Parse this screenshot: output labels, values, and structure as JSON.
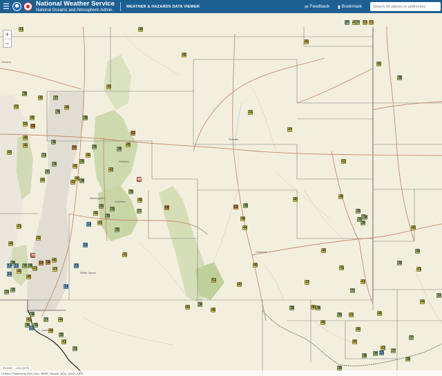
{
  "header": {
    "menu_icon": "hamburger-icon",
    "title": "National Weather Service",
    "subtitle": "National Oceanic and Atmospheric Admin.",
    "app_title": "WEATHER & HAZARDS DATA VIEWER",
    "feedback_label": "Feedback",
    "bookmark_label": "Bookmark",
    "search_placeholder": "Search for places or addresses"
  },
  "zoom": {
    "in_label": "+",
    "out_label": "−"
  },
  "colors": {
    "header": "#1e5f92",
    "map_background": "#f3efdf",
    "obs_40": "#e8d84a",
    "obs_30": "#b5d77a",
    "obs_20": "#8dcf9e",
    "obs_10": "#6fb9ea",
    "obs_60": "#e9a03c",
    "obs_80": "#d94a2a"
  },
  "towns": [
    "Socorro",
    "Roswell",
    "Carlsbad",
    "Alamogordo",
    "Juarez",
    "Ruidoso",
    "Tularosa",
    "White Sands"
  ],
  "observations": [
    {
      "id": "o1",
      "v": "41"
    },
    {
      "id": "o2",
      "v": "40"
    },
    {
      "id": "o3",
      "v": "52"
    },
    {
      "id": "o4",
      "v": "51"
    },
    {
      "id": "o5",
      "v": "42"
    },
    {
      "id": "o6",
      "v": "27"
    },
    {
      "id": "o7",
      "v": "37"
    },
    {
      "id": "o8",
      "v": "40"
    },
    {
      "id": "o9",
      "v": "40"
    },
    {
      "id": "o10",
      "v": "40"
    },
    {
      "id": "o11",
      "v": "45"
    },
    {
      "id": "o12",
      "v": "38"
    },
    {
      "id": "o13",
      "v": "38"
    },
    {
      "id": "o14",
      "v": "40"
    },
    {
      "id": "o15",
      "v": "37"
    },
    {
      "id": "o16",
      "v": "36"
    },
    {
      "id": "o17",
      "v": "46"
    },
    {
      "id": "o18",
      "v": "49"
    },
    {
      "id": "o19",
      "v": "41"
    },
    {
      "id": "o20",
      "v": "38"
    },
    {
      "id": "o21",
      "v": "50"
    },
    {
      "id": "o22",
      "v": "58"
    },
    {
      "id": "o23",
      "v": "62"
    },
    {
      "id": "o24",
      "v": "46"
    },
    {
      "id": "o25",
      "v": "45"
    },
    {
      "id": "o26",
      "v": "55"
    },
    {
      "id": "o27",
      "v": "36"
    },
    {
      "id": "o28",
      "v": "31"
    },
    {
      "id": "o29",
      "v": "40"
    },
    {
      "id": "o30",
      "v": "43"
    },
    {
      "id": "o31",
      "v": "36"
    },
    {
      "id": "o32",
      "v": "39"
    },
    {
      "id": "o33",
      "v": "41"
    },
    {
      "id": "o34",
      "v": "52"
    },
    {
      "id": "o35",
      "v": "47"
    },
    {
      "id": "o36",
      "v": "40"
    },
    {
      "id": "o37",
      "v": "30"
    },
    {
      "id": "o38",
      "v": "39"
    },
    {
      "id": "o39",
      "v": "30"
    },
    {
      "id": "o40",
      "v": "40"
    },
    {
      "id": "o41",
      "v": "40"
    },
    {
      "id": "o42",
      "v": "42"
    },
    {
      "id": "o43",
      "v": "83"
    },
    {
      "id": "o44",
      "v": "43"
    },
    {
      "id": "o45",
      "v": "40"
    },
    {
      "id": "o46",
      "v": "38"
    },
    {
      "id": "o47",
      "v": "35"
    },
    {
      "id": "o48",
      "v": "12"
    },
    {
      "id": "o49",
      "v": "10"
    },
    {
      "id": "o50",
      "v": "13"
    },
    {
      "id": "o51",
      "v": "14"
    },
    {
      "id": "o52",
      "v": "39"
    },
    {
      "id": "o53",
      "v": "40"
    },
    {
      "id": "o54",
      "v": "43"
    },
    {
      "id": "o55",
      "v": "68"
    },
    {
      "id": "o56",
      "v": "35"
    },
    {
      "id": "o57",
      "v": "39"
    },
    {
      "id": "o58",
      "v": "40"
    },
    {
      "id": "o59",
      "v": "37"
    },
    {
      "id": "o60",
      "v": "39"
    },
    {
      "id": "o61",
      "v": "41"
    },
    {
      "id": "o62",
      "v": "73"
    },
    {
      "id": "o63",
      "v": "64"
    },
    {
      "id": "o64",
      "v": "58"
    },
    {
      "id": "o65",
      "v": "44"
    },
    {
      "id": "o66",
      "v": "42"
    },
    {
      "id": "o67",
      "v": "43"
    },
    {
      "id": "o68",
      "v": "47"
    },
    {
      "id": "o69",
      "v": "38"
    },
    {
      "id": "o70",
      "v": "39"
    },
    {
      "id": "o71",
      "v": "38"
    },
    {
      "id": "o72",
      "v": "40"
    },
    {
      "id": "o73",
      "v": "14"
    },
    {
      "id": "o74",
      "v": "10"
    },
    {
      "id": "o75",
      "v": "40"
    },
    {
      "id": "o76",
      "v": "35"
    },
    {
      "id": "o77",
      "v": "33"
    },
    {
      "id": "o78",
      "v": "41"
    },
    {
      "id": "o79",
      "v": "40"
    },
    {
      "id": "o80",
      "v": "14"
    },
    {
      "id": "o81",
      "v": "38"
    },
    {
      "id": "o82",
      "v": "42"
    },
    {
      "id": "o83",
      "v": "38"
    },
    {
      "id": "o84",
      "v": "39"
    },
    {
      "id": "o85",
      "v": "37"
    },
    {
      "id": "o86",
      "v": "44"
    },
    {
      "id": "o87",
      "v": "35"
    },
    {
      "id": "o88",
      "v": "13"
    },
    {
      "id": "o89",
      "v": "40"
    },
    {
      "id": "o90",
      "v": "41"
    },
    {
      "id": "o91",
      "v": "31"
    },
    {
      "id": "o92",
      "v": "60"
    },
    {
      "id": "o93",
      "v": "44"
    },
    {
      "id": "o94",
      "v": "46"
    },
    {
      "id": "o95",
      "v": "45"
    },
    {
      "id": "o96",
      "v": "38"
    },
    {
      "id": "o97",
      "v": "40"
    },
    {
      "id": "o98",
      "v": "45"
    },
    {
      "id": "o99",
      "v": "40"
    },
    {
      "id": "o100",
      "v": "40"
    },
    {
      "id": "o101",
      "v": "38"
    },
    {
      "id": "o102",
      "v": "35"
    },
    {
      "id": "o103",
      "v": "35"
    },
    {
      "id": "o104",
      "v": "36"
    },
    {
      "id": "o105",
      "v": "38"
    },
    {
      "id": "o106",
      "v": "41"
    },
    {
      "id": "o107",
      "v": "47"
    },
    {
      "id": "o108",
      "v": "40"
    },
    {
      "id": "o109",
      "v": "37"
    },
    {
      "id": "o110",
      "v": "41"
    },
    {
      "id": "o111",
      "v": "51"
    },
    {
      "id": "o112",
      "v": "40"
    },
    {
      "id": "o113",
      "v": "36"
    },
    {
      "id": "o114",
      "v": "40"
    },
    {
      "id": "o115",
      "v": "46"
    },
    {
      "id": "o116",
      "v": "41"
    },
    {
      "id": "o117",
      "v": "38"
    },
    {
      "id": "o118",
      "v": "38"
    },
    {
      "id": "o119",
      "v": "39"
    },
    {
      "id": "o120",
      "v": "40"
    },
    {
      "id": "o121",
      "v": "40"
    },
    {
      "id": "o122",
      "v": "40"
    },
    {
      "id": "o123",
      "v": "39"
    },
    {
      "id": "o124",
      "v": "41"
    },
    {
      "id": "o125",
      "v": "39"
    },
    {
      "id": "o126",
      "v": "32"
    },
    {
      "id": "o127",
      "v": "37"
    },
    {
      "id": "o128",
      "v": "40"
    },
    {
      "id": "o129",
      "v": "44"
    },
    {
      "id": "o130",
      "v": "43"
    },
    {
      "id": "o131",
      "v": "38"
    },
    {
      "id": "o132",
      "v": "35"
    },
    {
      "id": "o133",
      "v": "37"
    },
    {
      "id": "o134",
      "v": "15"
    },
    {
      "id": "o135",
      "v": "39"
    },
    {
      "id": "o136",
      "v": "38"
    }
  ],
  "coordinates": "33.4252 , -105.12073",
  "attribution": {
    "leaflet": "Leaflet",
    "text": " | Powered by Esri | Esri, HERE, Garmin, NGA, USGS, NPS"
  }
}
